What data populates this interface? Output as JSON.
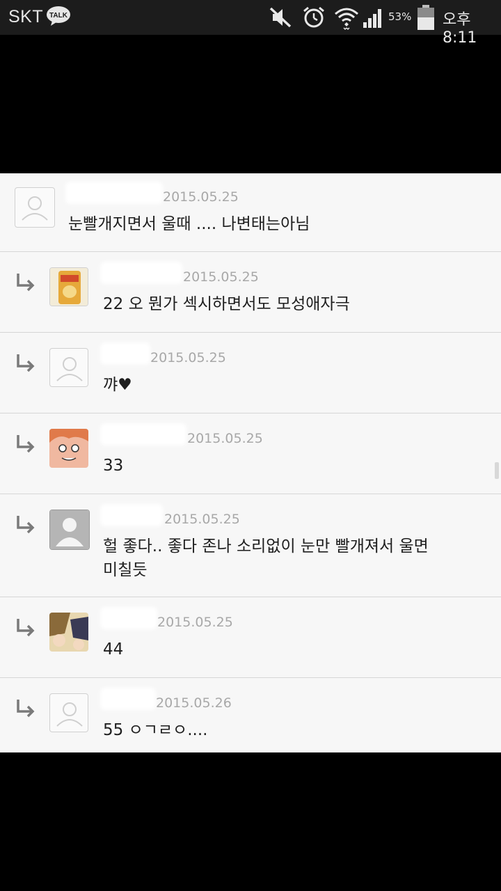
{
  "status_bar": {
    "carrier": "SKT",
    "talk_badge": "TALK",
    "battery_percent": "53%",
    "time": "오후 8:11"
  },
  "comments": [
    {
      "date": "2015.05.25",
      "text": "눈빨개지면서 울때 .... 나변태는아님",
      "avatar": "default-avatar-icon",
      "reply": false
    },
    {
      "date": "2015.05.25",
      "text": "22 오 뭔가 섹시하면서도 모성애자극",
      "avatar": "snack-bag-avatar",
      "reply": true
    },
    {
      "date": "2015.05.25",
      "text": "꺄♥",
      "avatar": "default-avatar-icon",
      "reply": true
    },
    {
      "date": "2015.05.25",
      "text": "33",
      "avatar": "anime-face-avatar",
      "reply": true
    },
    {
      "date": "2015.05.25",
      "text": "헐 좋다.. 좋다 존나 소리없이 눈만 빨개져서 울면",
      "text2": "미칠듯",
      "avatar": "gray-silhouette-avatar",
      "reply": true
    },
    {
      "date": "2015.05.25",
      "text": "44",
      "avatar": "anime-characters-avatar",
      "reply": true
    },
    {
      "date": "2015.05.26",
      "text": "55 ㅇㄱㄹㅇ....",
      "avatar": "default-avatar-icon",
      "reply": true
    }
  ],
  "colors": {
    "status_bar": "#1c1c1c",
    "panel": "#f7f7f7",
    "divider": "#d6d6d6",
    "date_text": "#a8a8a8",
    "body_text": "#1e1e1e"
  }
}
